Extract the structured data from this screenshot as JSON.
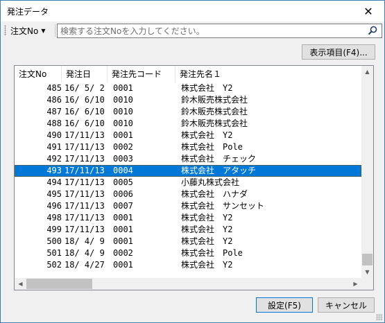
{
  "window": {
    "title": "発注データ",
    "close_glyph": "✕"
  },
  "search": {
    "field": "注文No",
    "placeholder": "検索する注文Noを入力してください。"
  },
  "buttons": {
    "columns": "表示項目(F4)...",
    "settings": "設定(F5)",
    "cancel": "キャンセル"
  },
  "columns": [
    "注文No",
    "発注日",
    "発注先コード",
    "発注先名１"
  ],
  "rows": [
    {
      "no": "485",
      "date": "16/ 5/ 2",
      "code": "0001",
      "name": "株式会社　Y2"
    },
    {
      "no": "486",
      "date": "16/ 6/10",
      "code": "0010",
      "name": "鈴木販売株式会社"
    },
    {
      "no": "487",
      "date": "16/ 6/10",
      "code": "0010",
      "name": "鈴木販売株式会社"
    },
    {
      "no": "488",
      "date": "16/ 6/10",
      "code": "0010",
      "name": "鈴木販売株式会社"
    },
    {
      "no": "490",
      "date": "17/11/13",
      "code": "0001",
      "name": "株式会社　Y2"
    },
    {
      "no": "491",
      "date": "17/11/13",
      "code": "0002",
      "name": "株式会社　Pole"
    },
    {
      "no": "492",
      "date": "17/11/13",
      "code": "0003",
      "name": "株式会社　チェック"
    },
    {
      "no": "493",
      "date": "17/11/13",
      "code": "0004",
      "name": "株式会社　アタッチ"
    },
    {
      "no": "494",
      "date": "17/11/13",
      "code": "0005",
      "name": "小藤丸株式会社"
    },
    {
      "no": "495",
      "date": "17/11/13",
      "code": "0006",
      "name": "株式会社　ハナダ"
    },
    {
      "no": "496",
      "date": "17/11/13",
      "code": "0007",
      "name": "株式会社　サンセット"
    },
    {
      "no": "498",
      "date": "17/11/13",
      "code": "0001",
      "name": "株式会社　Y2"
    },
    {
      "no": "499",
      "date": "17/11/13",
      "code": "0001",
      "name": "株式会社　Y2"
    },
    {
      "no": "500",
      "date": "18/ 4/ 9",
      "code": "0001",
      "name": "株式会社　Y2"
    },
    {
      "no": "501",
      "date": "18/ 4/ 9",
      "code": "0002",
      "name": "株式会社　Pole"
    },
    {
      "no": "502",
      "date": "18/ 4/27",
      "code": "0001",
      "name": "株式会社　Y2"
    }
  ],
  "selected_index": 7,
  "colors": {
    "accent": "#0078d7",
    "border": "#3c7fb1"
  },
  "icons": {
    "search": "search-icon",
    "close": "close-icon",
    "dropdown": "chevron-down-icon"
  }
}
